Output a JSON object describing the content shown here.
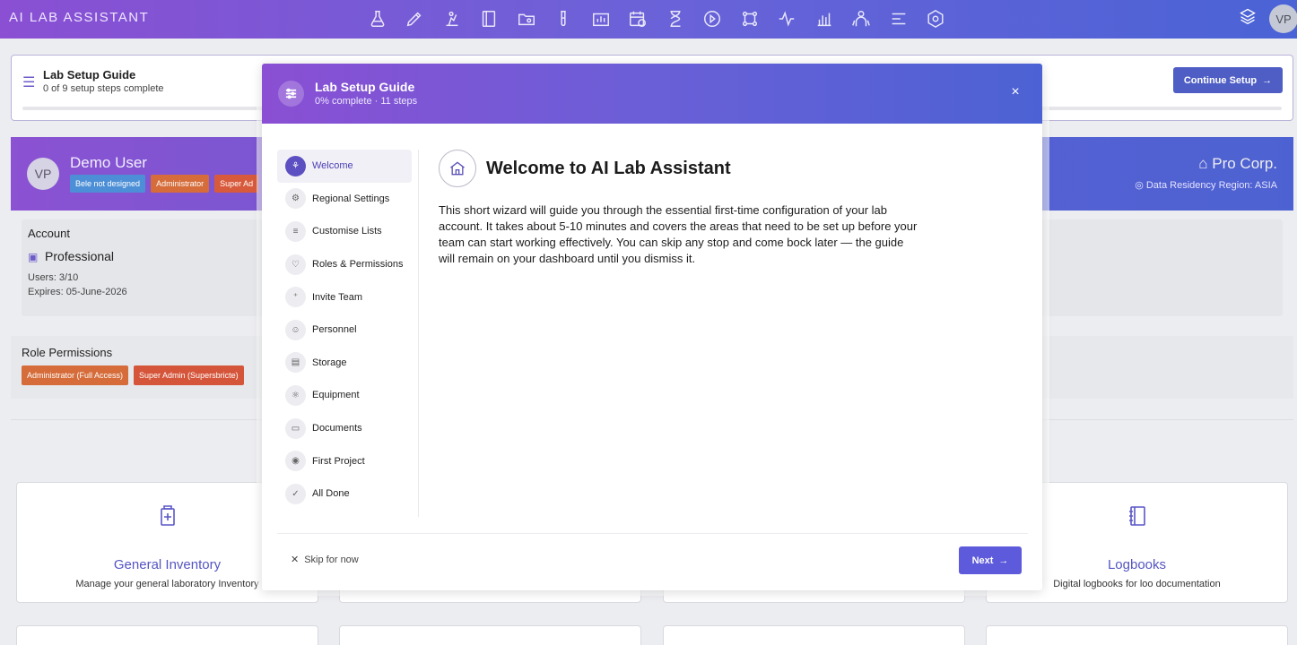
{
  "app": {
    "logo": "AI LAB ASSISTANT",
    "avatar_initials": "VP"
  },
  "nav": {
    "icons": [
      "flask-icon",
      "pen-icon",
      "beaker-icon",
      "notebook-icon",
      "folder-icon",
      "test-tube-icon",
      "chart-box-icon",
      "calendar-clock-icon",
      "hourglass-icon",
      "play-circle-icon",
      "workflow-icon",
      "activity-icon",
      "bar-chart-icon",
      "team-icon",
      "menu-icon",
      "settings-hexagon-icon"
    ]
  },
  "background": {
    "setup_guide": {
      "title": "Lab Setup Guide",
      "subtitle": "0 of 9 setup steps complete",
      "continue_label": "Continue Setup"
    },
    "profile": {
      "initials": "VP",
      "name": "Demo User",
      "badges": [
        {
          "label": "Bele not designed",
          "color": "#4d8fd6"
        },
        {
          "label": "Administrator",
          "color": "#d56c3a"
        },
        {
          "label": "Super Ad",
          "color": "#d85a3c"
        }
      ],
      "org": "Pro Corp.",
      "residency": "Data Residency Region: ASIA"
    },
    "account": {
      "label": "Account",
      "plan": "Professional",
      "users": "Users: 3/10",
      "expires": "Expires: 05-June-2026"
    },
    "roles": {
      "label": "Role Permissions",
      "badges": [
        "Administrator (Full Access)",
        "Super Admin (Supersbricte)"
      ]
    },
    "modules": [
      {
        "title": "General Inventory",
        "desc": "Manage your general laboratory Inventory",
        "icon": "inventory-icon"
      },
      {
        "title": "Logbooks",
        "desc": "Digital logbooks for loo documentation",
        "icon": "logbook-icon"
      }
    ]
  },
  "modal": {
    "title": "Lab Setup Guide",
    "subtitle": "0% complete · 11 steps",
    "close": "×",
    "steps": [
      {
        "label": "Welcome",
        "icon": "rocket-icon",
        "glyph": "⚘",
        "active": true
      },
      {
        "label": "Regional Settings",
        "icon": "gear-icon",
        "glyph": "⚙",
        "active": false
      },
      {
        "label": "Customise Lists",
        "icon": "sliders-icon",
        "glyph": "≡",
        "active": false
      },
      {
        "label": "Roles & Permissions",
        "icon": "shield-icon",
        "glyph": "♡",
        "active": false
      },
      {
        "label": "Invite Team",
        "icon": "user-plus-icon",
        "glyph": "⁺",
        "active": false
      },
      {
        "label": "Personnel",
        "icon": "people-icon",
        "glyph": "☺",
        "active": false
      },
      {
        "label": "Storage",
        "icon": "database-icon",
        "glyph": "▤",
        "active": false
      },
      {
        "label": "Equipment",
        "icon": "equipment-icon",
        "glyph": "⚛",
        "active": false
      },
      {
        "label": "Documents",
        "icon": "folder-open-icon",
        "glyph": "▭",
        "active": false
      },
      {
        "label": "First Project",
        "icon": "eye-icon",
        "glyph": "◉",
        "active": false
      },
      {
        "label": "All Done",
        "icon": "check-circle-icon",
        "glyph": "✓",
        "active": false
      }
    ],
    "content": {
      "title": "Welcome to AI Lab Assistant",
      "body": "This short wizard will guide you through the essential first-time configuration of your lab account. It takes about 5-10 minutes and covers the areas that need to be set up before your team can start working effectively. You can skip any stop and come bock later — the guide will remain on your dashboard until you dismiss it."
    },
    "skip_label": "Skip for now",
    "next_label": "Next"
  }
}
